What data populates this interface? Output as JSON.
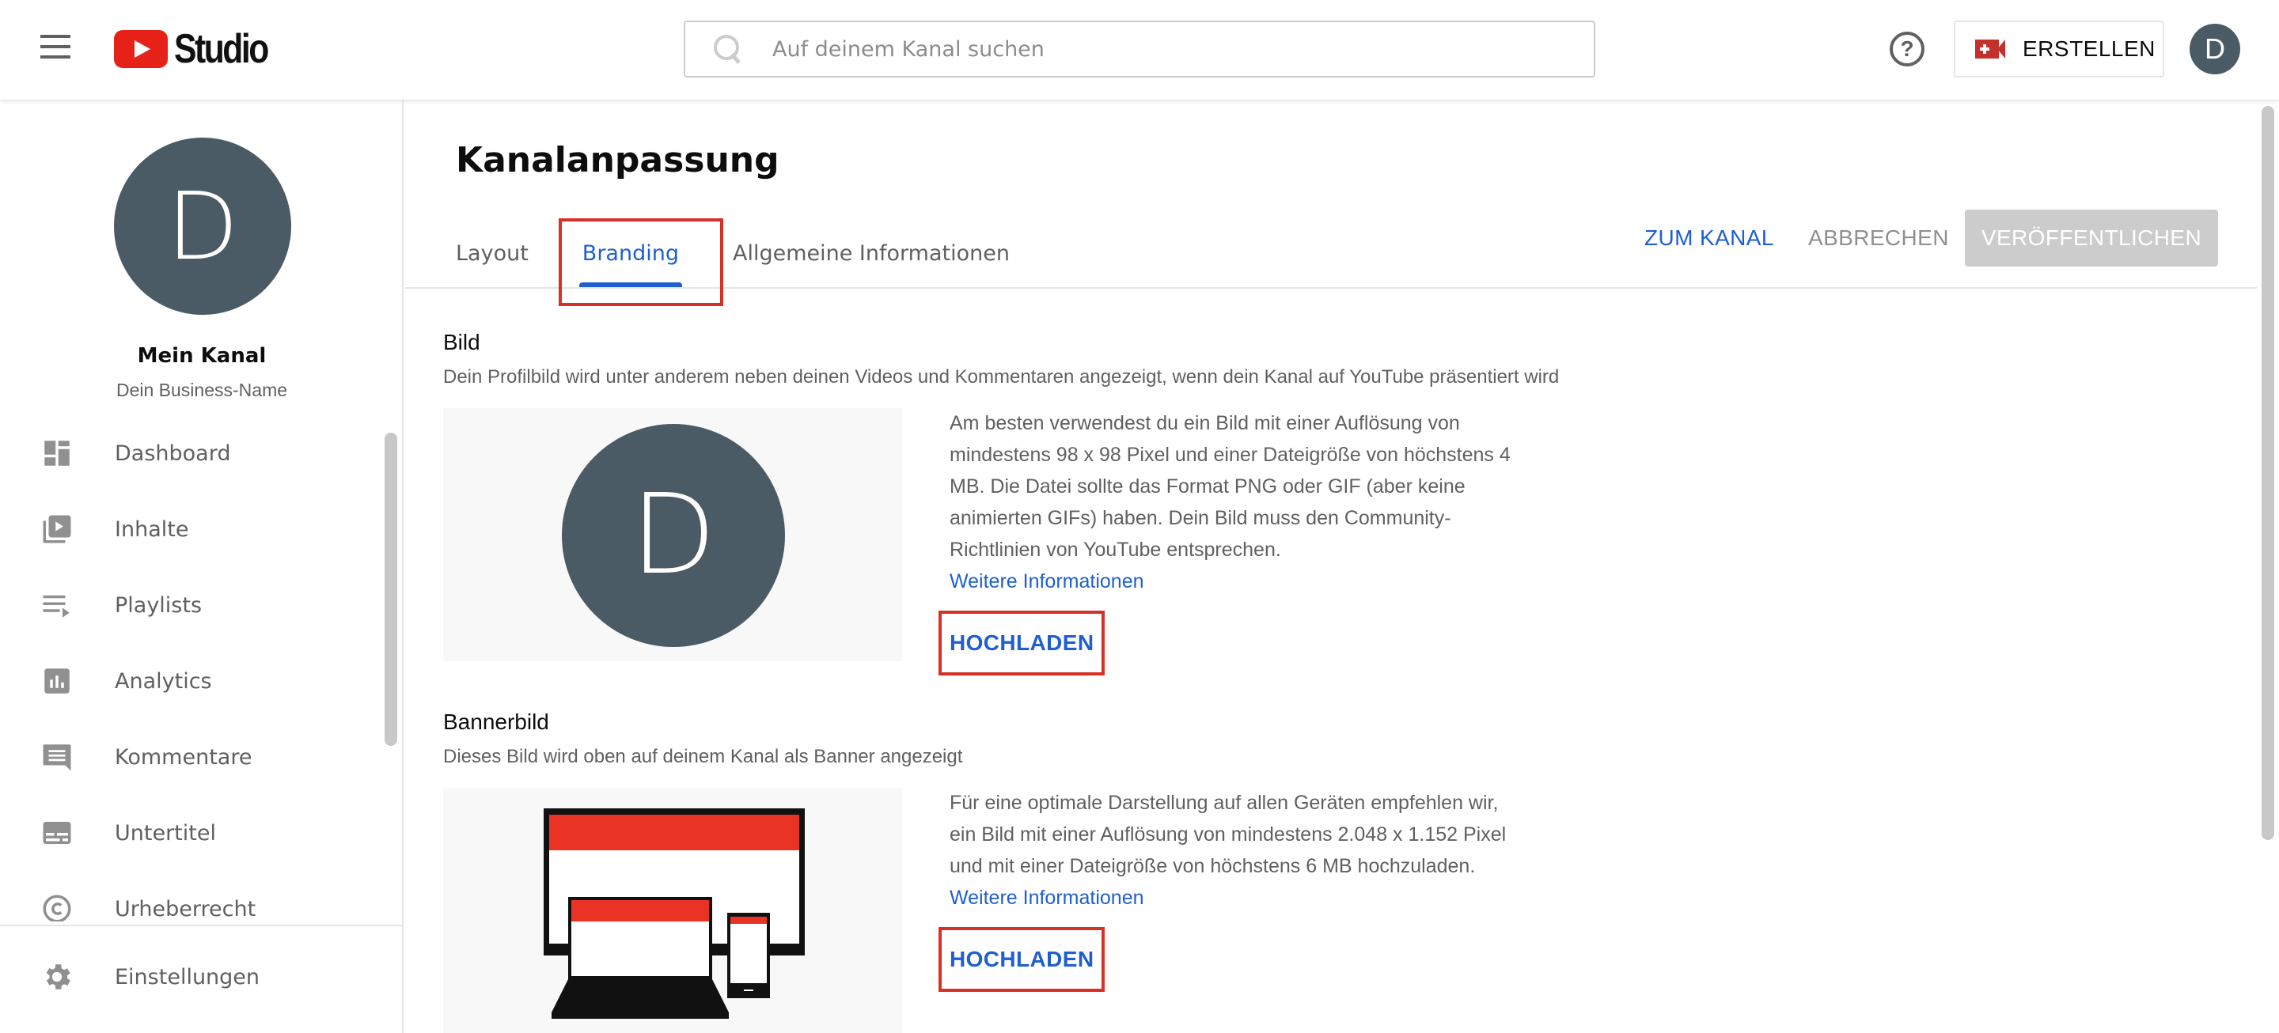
{
  "header": {
    "logo_text": "Studio",
    "search_placeholder": "Auf deinem Kanal suchen",
    "create_label": "ERSTELLEN",
    "avatar_initial": "D",
    "icons": {
      "menu": "hamburger-menu-icon",
      "logo": "youtube-play-icon",
      "search": "search-icon",
      "help": "help-circle-icon",
      "create": "video-camera-plus-icon"
    },
    "help_glyph": "?"
  },
  "sidebar": {
    "avatar_initial": "D",
    "channel_name": "Mein Kanal",
    "channel_subtitle": "Dein Business-Name",
    "items": [
      {
        "label": "Dashboard",
        "icon": "dashboard-icon"
      },
      {
        "label": "Inhalte",
        "icon": "video-library-icon"
      },
      {
        "label": "Playlists",
        "icon": "playlist-icon"
      },
      {
        "label": "Analytics",
        "icon": "analytics-icon"
      },
      {
        "label": "Kommentare",
        "icon": "comment-icon"
      },
      {
        "label": "Untertitel",
        "icon": "subtitles-icon"
      },
      {
        "label": "Urheberrecht",
        "icon": "copyright-icon"
      }
    ],
    "settings": {
      "label": "Einstellungen",
      "icon": "gear-icon"
    }
  },
  "main": {
    "title": "Kanalanpassung",
    "tabs": [
      {
        "label": "Layout",
        "active": false
      },
      {
        "label": "Branding",
        "active": true
      },
      {
        "label": "Allgemeine Informationen",
        "active": false
      }
    ],
    "actions": {
      "to_channel": "ZUM KANAL",
      "cancel": "ABBRECHEN",
      "publish": "VERÖFFENTLICHEN"
    },
    "picture": {
      "title": "Bild",
      "description": "Dein Profilbild wird unter anderem neben deinen Videos und Kommentaren angezeigt, wenn dein Kanal auf YouTube präsentiert wird",
      "preview_initial": "D",
      "info": "Am besten verwendest du ein Bild mit einer Auflösung von mindestens 98 x 98 Pixel und einer Dateigröße von höchstens 4 MB. Die Datei sollte das Format PNG oder GIF (aber keine animierten GIFs) haben. Dein Bild muss den Community-Richtlinien von YouTube entsprechen.",
      "more_info": "Weitere Informationen",
      "upload": "HOCHLADEN"
    },
    "banner": {
      "title": "Bannerbild",
      "description": "Dieses Bild wird oben auf deinem Kanal als Banner angezeigt",
      "info": "Für eine optimale Darstellung auf allen Geräten empfehlen wir, ein Bild mit einer Auflösung von mindestens 2.048 x 1.152 Pixel und mit einer Dateigröße von höchstens 6 MB hochzuladen.",
      "more_info": "Weitere Informationen",
      "upload": "HOCHLADEN",
      "preview_icon": "devices-banner-illustration"
    }
  },
  "colors": {
    "accent_blue": "#1f5fcf",
    "youtube_red": "#e62117",
    "highlight_red": "#d93025",
    "avatar_bg": "#4b5b66"
  }
}
